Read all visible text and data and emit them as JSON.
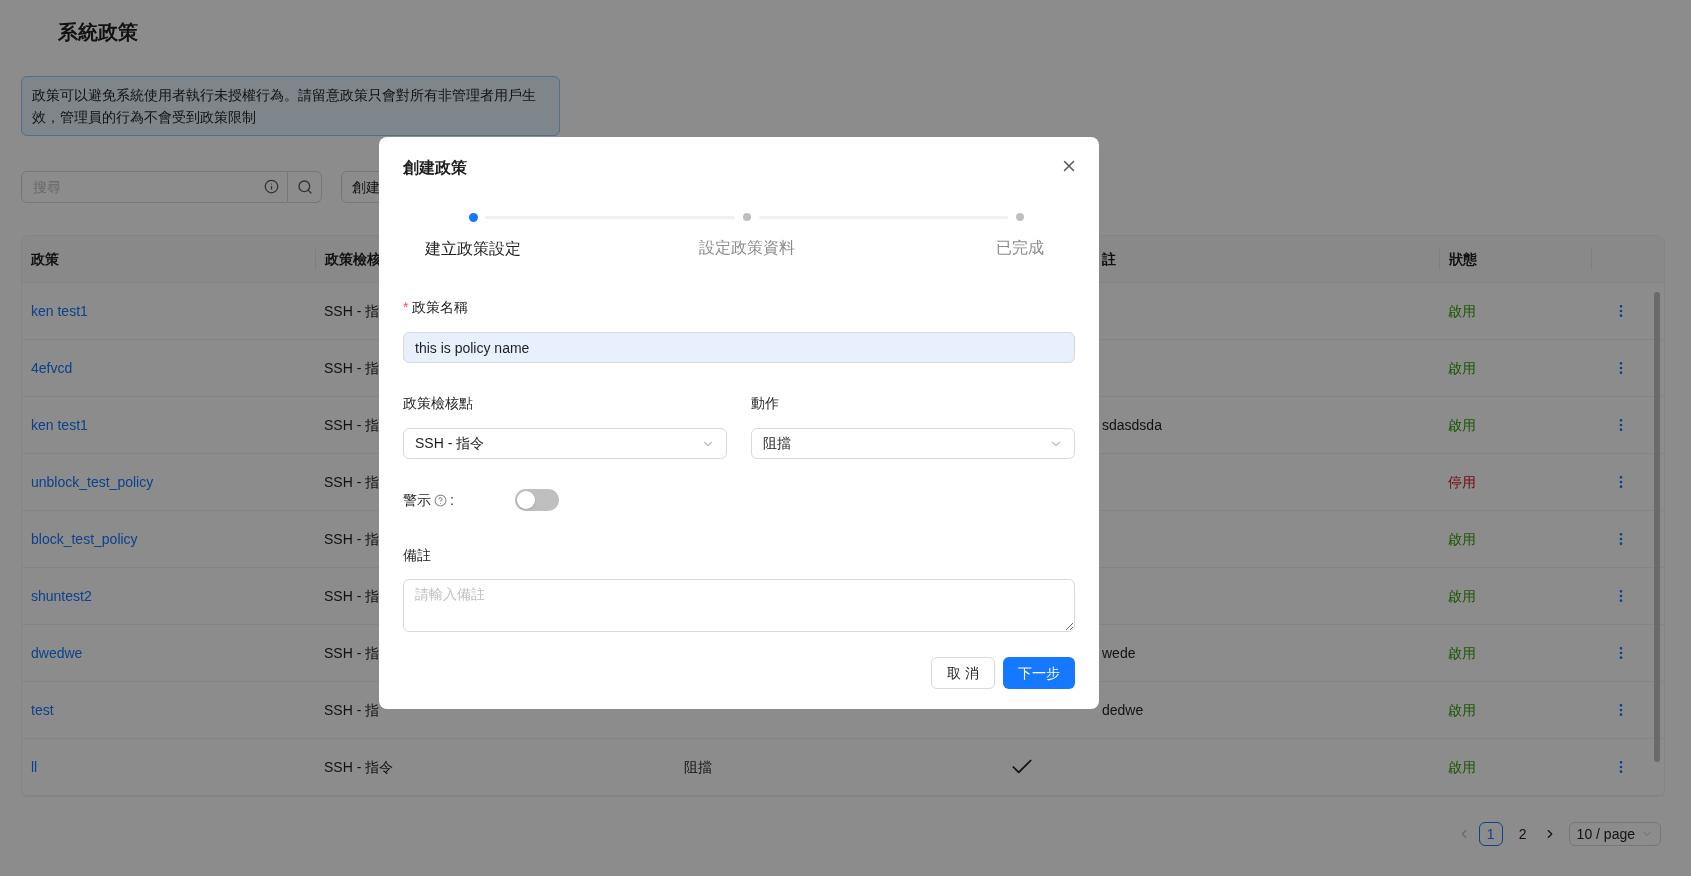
{
  "page": {
    "title": "系統政策"
  },
  "notice": "政策可以避免系統使用者執行未授權行為。請留意政策只會對所有非管理者用戶生效，管理員的行為不會受到政策限制",
  "toolbar": {
    "search": {
      "placeholder": "搜尋"
    },
    "create_button": "創建"
  },
  "table": {
    "columns": {
      "policy": "政策",
      "column_2": "政策檢核",
      "column_5": "註",
      "status": "狀態"
    },
    "rows": [
      {
        "policy": "ken test1",
        "column_2": "SSH - 指",
        "status": "啟用",
        "enabled": true
      },
      {
        "policy": "4efvcd",
        "column_2": "SSH - 指",
        "status": "啟用",
        "enabled": true
      },
      {
        "policy": "ken test1",
        "column_2": "SSH - 指",
        "column_5": "sdasdsda",
        "status": "啟用",
        "enabled": true
      },
      {
        "policy": "unblock_test_policy",
        "column_2": "SSH - 指",
        "status": "停用",
        "enabled": false
      },
      {
        "policy": "block_test_policy",
        "column_2": "SSH - 指",
        "status": "啟用",
        "enabled": true
      },
      {
        "policy": "shuntest2",
        "column_2": "SSH - 指",
        "status": "啟用",
        "enabled": true
      },
      {
        "policy": "dwedwe",
        "column_2": "SSH - 指",
        "column_5": "wede",
        "status": "啟用",
        "enabled": true
      },
      {
        "policy": "test",
        "column_2": "SSH - 指",
        "column_5": "dedwe",
        "status": "啟用",
        "enabled": true
      },
      {
        "policy": "ll",
        "column_2": "SSH - 指令",
        "column_3": "阻擋",
        "column_4_checked": true,
        "status": "啟用",
        "enabled": true
      }
    ]
  },
  "pagination": {
    "prev_disabled": true,
    "pages": [
      {
        "label": "1",
        "selected": true
      },
      {
        "label": "2",
        "selected": false
      }
    ],
    "page_size": "10 / page"
  },
  "modal": {
    "title": "創建政策",
    "steps": [
      {
        "label": "建立政策設定",
        "selected": true
      },
      {
        "label": "設定政策資料",
        "selected": false
      },
      {
        "label": "已完成",
        "selected": false
      }
    ],
    "name_field": {
      "label": "政策名稱",
      "required_mark": "*",
      "value": "this is policy name"
    },
    "checkpoint_select": {
      "label": "政策檢核點",
      "value": "SSH - 指令"
    },
    "action_select": {
      "label": "動作",
      "value": "阻擋"
    },
    "alert_toggle": {
      "label": "警示",
      "suffix": ":",
      "on": false
    },
    "remark_field": {
      "label": "備註",
      "placeholder": "請輸入備註"
    },
    "buttons": {
      "cancel": "取 消",
      "next": "下一步"
    }
  }
}
